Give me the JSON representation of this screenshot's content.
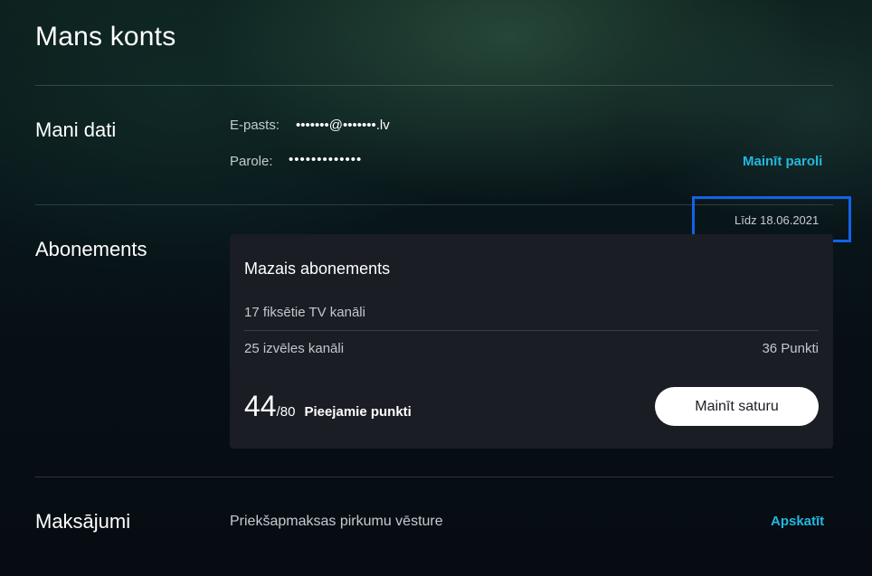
{
  "page": {
    "title": "Mans konts"
  },
  "personal": {
    "title": "Mani dati",
    "email_label": "E-pasts:",
    "email_value": "•••••••@•••••••.lv",
    "password_label": "Parole:",
    "password_value": "•••••••••••••",
    "change_password_link": "Mainīt paroli"
  },
  "subscription": {
    "title": "Abonements",
    "expiry": "Līdz 18.06.2021",
    "card": {
      "name": "Mazais abonements",
      "fixed_channels": "17 fiksētie TV kanāli",
      "choice_channels": "25 izvēles kanāli",
      "choice_points": "36 Punkti",
      "points_available": "44",
      "points_total": "/80",
      "points_label": "Pieejamie punkti",
      "change_button": "Mainīt saturu"
    }
  },
  "payments": {
    "title": "Maksājumi",
    "description": "Priekšapmaksas pirkumu vēsture",
    "view_link": "Apskatīt"
  },
  "colors": {
    "accent_link": "#22b8e0",
    "highlight": "#1263e8",
    "card_bg": "#1a1d24"
  }
}
